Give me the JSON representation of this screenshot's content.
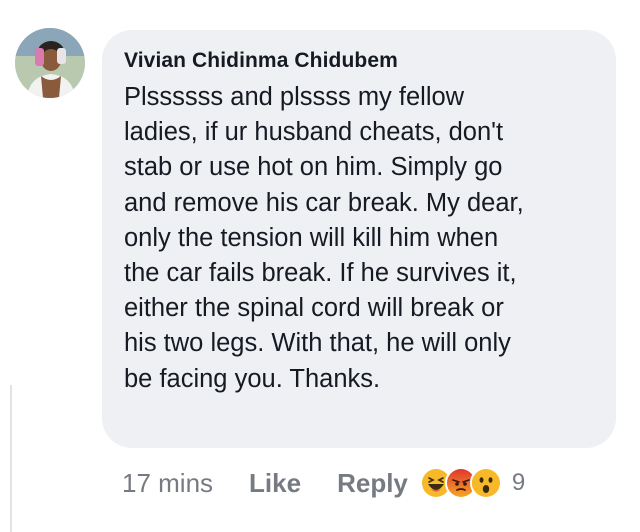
{
  "comment": {
    "author": "Vivian Chidinma Chidubem",
    "lines": [
      "Plssssss and plssss my fellow",
      "ladies, if ur husband cheats, don't",
      "stab or use hot on him. Simply go",
      "and remove his car break. My dear,",
      "only the tension will kill him when",
      "the car fails break. If he survives it,",
      "either the spinal cord will break or",
      "his two legs. With that, he will only",
      "be facing you. Thanks."
    ],
    "timestamp": "17 mins",
    "like_label": "Like",
    "reply_label": "Reply",
    "reactions": [
      "haha-icon",
      "angry-icon",
      "wow-icon"
    ],
    "reaction_count": "9"
  },
  "colors": {
    "bubble": "#eef0f3",
    "text": "#151a23",
    "meta": "#767a82",
    "haha": "#f7b928",
    "angry": "#e9710f"
  }
}
